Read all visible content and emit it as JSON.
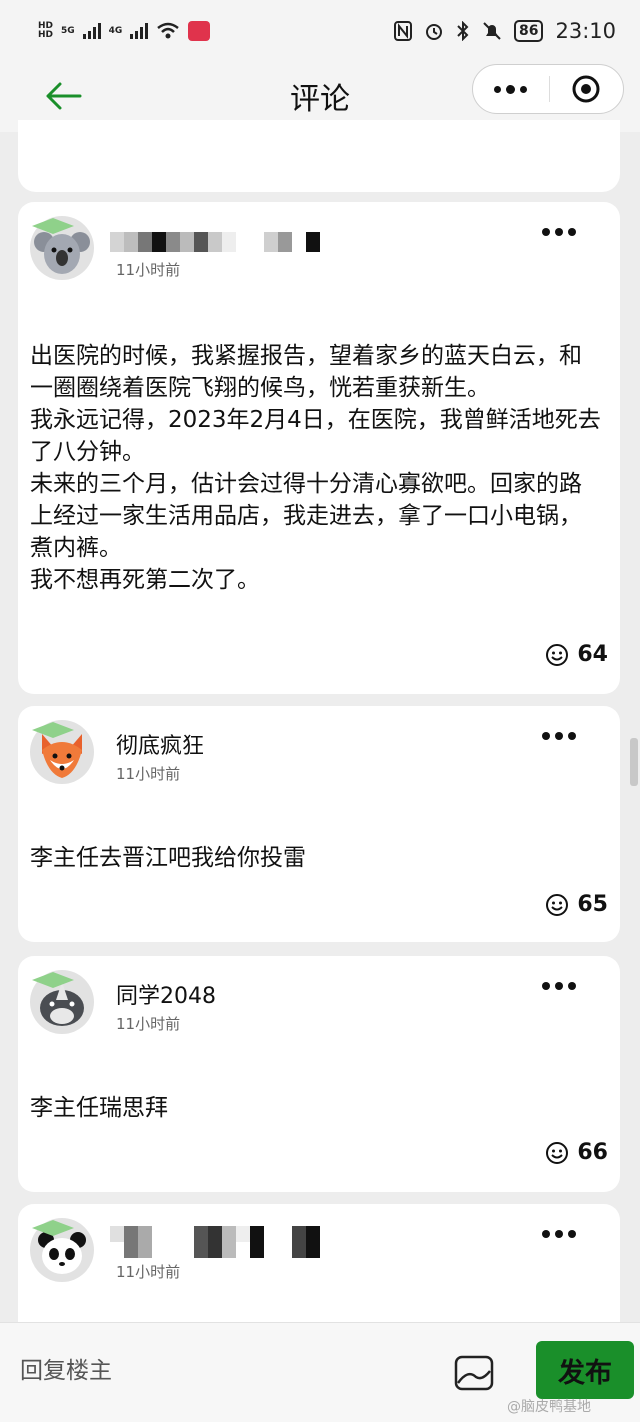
{
  "status_bar": {
    "network": [
      "HD",
      "5G",
      "HD",
      "4G"
    ],
    "battery": "86",
    "time": "23:10"
  },
  "header": {
    "title": "评论",
    "back_icon": "arrow-left-icon",
    "more_icon": "more-dots-icon",
    "close_icon": "target-circle-icon"
  },
  "comments": [
    {
      "username": "",
      "username_redacted": true,
      "time": "11小时前",
      "avatar": "koala",
      "text": "出医院的时候，我紧握报告，望着家乡的蓝天白云，和一圈圈绕着医院飞翔的候鸟，恍若重获新生。\n我永远记得，2023年2月4日，在医院，我曾鲜活地死去了八分钟。\n未来的三个月，估计会过得十分清心寡欲吧。回家的路上经过一家生活用品店，我走进去，拿了一口小电锅，煮内裤。\n我不想再死第二次了。",
      "likes": "64"
    },
    {
      "username": "彻底疯狂",
      "time": "11小时前",
      "avatar": "fox",
      "text": "李主任去晋江吧我给你投雷",
      "likes": "65"
    },
    {
      "username": "同学2048",
      "time": "11小时前",
      "avatar": "rhino",
      "text": "李主任瑞思拜",
      "likes": "66"
    },
    {
      "username": "",
      "username_redacted": true,
      "time": "11小时前",
      "avatar": "panda",
      "text": "",
      "likes": ""
    }
  ],
  "bottom_bar": {
    "reply_placeholder": "回复楼主",
    "publish_label": "发布",
    "image_icon": "image-icon"
  },
  "watermark": "@脑皮鸭基地",
  "colors": {
    "accent_green": "#1a8f2a",
    "background": "#ededed",
    "card": "#ffffff"
  }
}
